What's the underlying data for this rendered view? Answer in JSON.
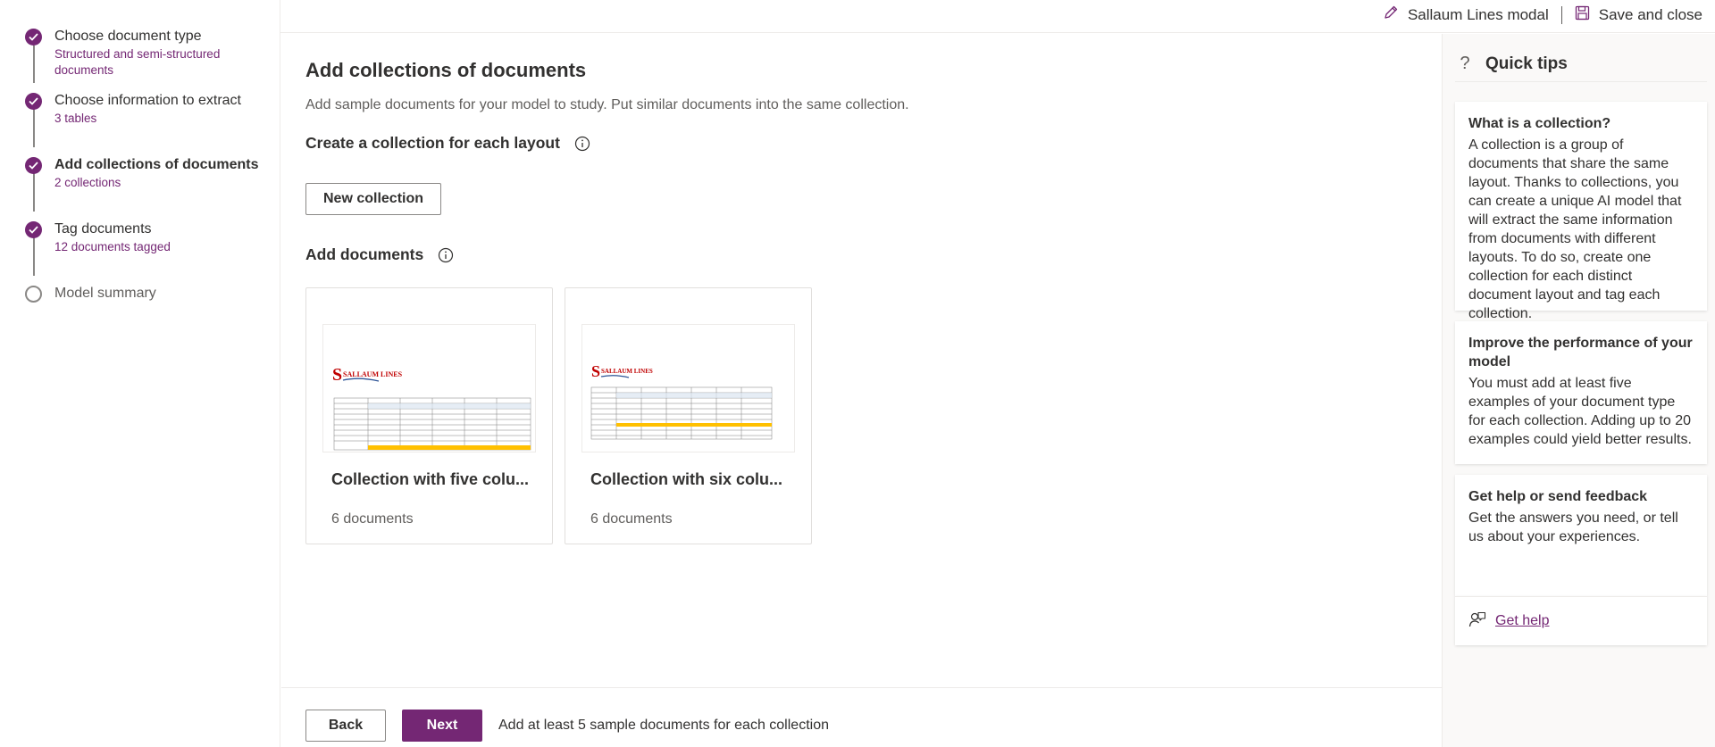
{
  "topbar": {
    "model_name": "Sallaum Lines modal",
    "save_close_label": "Save and close"
  },
  "stepper": {
    "steps": [
      {
        "title": "Choose document type",
        "subtitle": "Structured and semi-structured documents",
        "state": "done"
      },
      {
        "title": "Choose information to extract",
        "subtitle": "3 tables",
        "state": "done"
      },
      {
        "title": "Add collections of documents",
        "subtitle": "2 collections",
        "state": "current"
      },
      {
        "title": "Tag documents",
        "subtitle": "12 documents tagged",
        "state": "done"
      },
      {
        "title": "Model summary",
        "subtitle": "",
        "state": "todo"
      }
    ]
  },
  "main": {
    "title": "Add collections of documents",
    "description": "Add sample documents for your model to study. Put similar documents into the same collection.",
    "create_heading": "Create a collection for each layout",
    "new_collection_label": "New collection",
    "add_documents_heading": "Add documents",
    "collections": [
      {
        "name": "Collection with five colu...",
        "count": "6 documents",
        "thumb_logo": "SALLAUM LINES"
      },
      {
        "name": "Collection with six colu...",
        "count": "6 documents",
        "thumb_logo": "SALLAUM LINES"
      }
    ]
  },
  "footer": {
    "back_label": "Back",
    "next_label": "Next",
    "hint": "Add at least 5 sample documents for each collection"
  },
  "tips": {
    "title": "Quick tips",
    "cards": [
      {
        "title": "What is a collection?",
        "body": "A collection is a group of documents that share the same layout. Thanks to collections, you can create a unique AI model that will extract the same information from documents with different layouts. To do so, create one collection for each distinct document layout and tag each collection."
      },
      {
        "title": "Improve the performance of your model",
        "body": "You must add at least five examples of your document type for each collection. Adding up to 20 examples could yield better results."
      },
      {
        "title": "Get help or send feedback",
        "body": "Get the answers you need, or tell us about your experiences."
      }
    ],
    "help_link": "Get help"
  },
  "colors": {
    "accent": "#742774",
    "border": "#8a8886",
    "text": "#323130",
    "muted": "#605e5c"
  }
}
